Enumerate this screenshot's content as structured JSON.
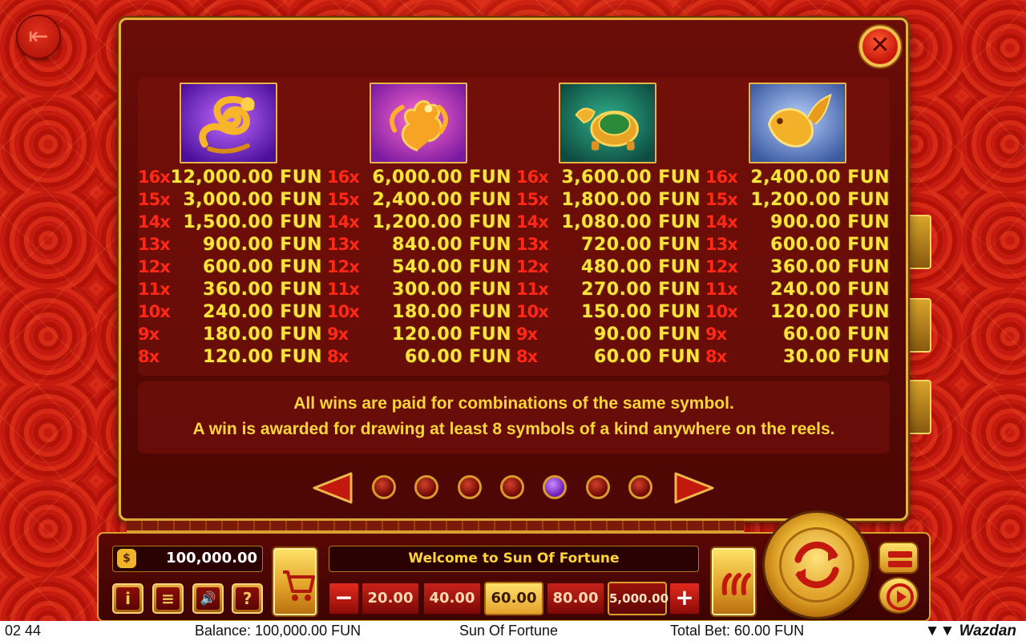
{
  "paytable": {
    "columns": [
      {
        "symbol": "dragon-icon",
        "rows": [
          {
            "mult": "16x",
            "amount": "12,000.00 FUN"
          },
          {
            "mult": "15x",
            "amount": "3,000.00 FUN"
          },
          {
            "mult": "14x",
            "amount": "1,500.00 FUN"
          },
          {
            "mult": "13x",
            "amount": "900.00 FUN"
          },
          {
            "mult": "12x",
            "amount": "600.00 FUN"
          },
          {
            "mult": "11x",
            "amount": "360.00 FUN"
          },
          {
            "mult": "10x",
            "amount": "240.00 FUN"
          },
          {
            "mult": "9x",
            "amount": "180.00 FUN"
          },
          {
            "mult": "8x",
            "amount": "120.00 FUN"
          }
        ]
      },
      {
        "symbol": "phoenix-icon",
        "rows": [
          {
            "mult": "16x",
            "amount": "6,000.00 FUN"
          },
          {
            "mult": "15x",
            "amount": "2,400.00 FUN"
          },
          {
            "mult": "14x",
            "amount": "1,200.00 FUN"
          },
          {
            "mult": "13x",
            "amount": "840.00 FUN"
          },
          {
            "mult": "12x",
            "amount": "540.00 FUN"
          },
          {
            "mult": "11x",
            "amount": "300.00 FUN"
          },
          {
            "mult": "10x",
            "amount": "180.00 FUN"
          },
          {
            "mult": "9x",
            "amount": "120.00 FUN"
          },
          {
            "mult": "8x",
            "amount": "60.00 FUN"
          }
        ]
      },
      {
        "symbol": "dragon-turtle-icon",
        "rows": [
          {
            "mult": "16x",
            "amount": "3,600.00 FUN"
          },
          {
            "mult": "15x",
            "amount": "1,800.00 FUN"
          },
          {
            "mult": "14x",
            "amount": "1,080.00 FUN"
          },
          {
            "mult": "13x",
            "amount": "720.00 FUN"
          },
          {
            "mult": "12x",
            "amount": "480.00 FUN"
          },
          {
            "mult": "11x",
            "amount": "270.00 FUN"
          },
          {
            "mult": "10x",
            "amount": "150.00 FUN"
          },
          {
            "mult": "9x",
            "amount": "90.00 FUN"
          },
          {
            "mult": "8x",
            "amount": "60.00 FUN"
          }
        ]
      },
      {
        "symbol": "koi-fish-icon",
        "rows": [
          {
            "mult": "16x",
            "amount": "2,400.00 FUN"
          },
          {
            "mult": "15x",
            "amount": "1,200.00 FUN"
          },
          {
            "mult": "14x",
            "amount": "900.00 FUN"
          },
          {
            "mult": "13x",
            "amount": "600.00 FUN"
          },
          {
            "mult": "12x",
            "amount": "360.00 FUN"
          },
          {
            "mult": "11x",
            "amount": "240.00 FUN"
          },
          {
            "mult": "10x",
            "amount": "120.00 FUN"
          },
          {
            "mult": "9x",
            "amount": "60.00 FUN"
          },
          {
            "mult": "8x",
            "amount": "30.00 FUN"
          }
        ]
      }
    ],
    "note_line1": "All wins are paid for combinations of the same symbol.",
    "note_line2": "A win is awarded for drawing at least 8 symbols of a kind anywhere on the reels.",
    "pages_total": 7,
    "current_page": 5
  },
  "controls": {
    "balance": "100,000.00",
    "message": "Welcome to Sun Of Fortune",
    "info_label": "i",
    "menu_label": "≡",
    "sound_label": "🔊",
    "help_label": "?",
    "minus_label": "−",
    "plus_label": "+",
    "bets": [
      "20.00",
      "40.00",
      "60.00",
      "80.00"
    ],
    "selected_bet": "60.00",
    "max_bet": "5,000.00"
  },
  "status_bar": {
    "time": "02 44",
    "balance": "Balance: 100,000.00 FUN",
    "game_title": "Sun Of Fortune",
    "total_bet": "Total Bet: 60.00 FUN",
    "brand": "Wazdan"
  },
  "colors": {
    "multiplier": "#ff2a16",
    "amount": "#ffe23c",
    "frame_gold": "#e8b23a",
    "active_dot": "#8a3ae0"
  }
}
